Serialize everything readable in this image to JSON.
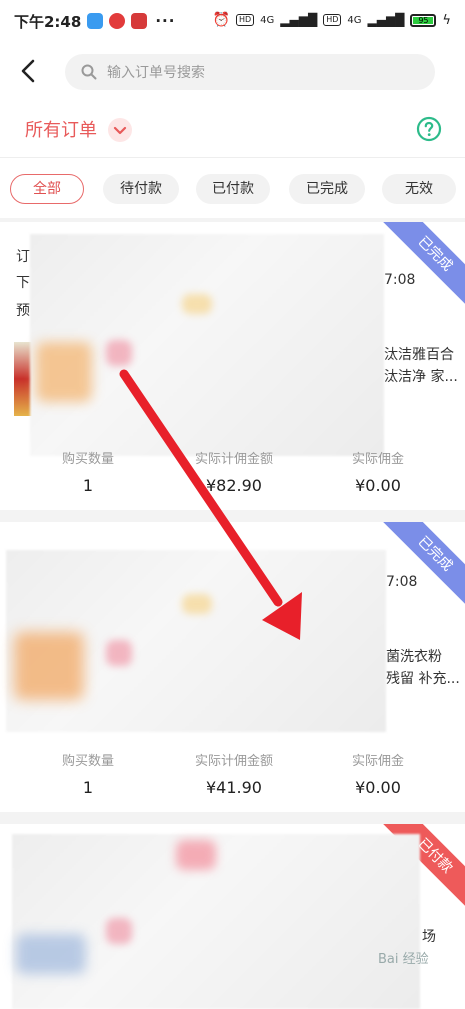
{
  "status_bar": {
    "time": "下午2:48",
    "more": "···",
    "signal_1": "4G",
    "signal_2": "4G",
    "chip_1": "HD",
    "chip_2": "HD",
    "battery": "95"
  },
  "header": {
    "search_placeholder": "输入订单号搜索"
  },
  "titlebar": {
    "title": "所有订单"
  },
  "tabs": [
    "全部",
    "待付款",
    "已付款",
    "已完成",
    "无效"
  ],
  "orders": [
    {
      "ribbon": "已完成",
      "ribbon_color": "#7b8ee8",
      "peek_left": [
        "订",
        "下",
        "预"
      ],
      "peek_time": "7:08",
      "peek_title_1": "汰洁雅百合",
      "peek_title_2": "汰洁净 家...",
      "labels": [
        "购买数量",
        "实际计佣金额",
        "实际佣金"
      ],
      "values": [
        "1",
        "¥82.90",
        "¥0.00"
      ]
    },
    {
      "ribbon": "已完成",
      "ribbon_color": "#7b8ee8",
      "peek_time": "7:08",
      "peek_title_1": "菌洗衣粉",
      "peek_title_2": "残留 补充...",
      "labels": [
        "购买数量",
        "实际计佣金额",
        "实际佣金"
      ],
      "values": [
        "1",
        "¥41.90",
        "¥0.00"
      ]
    },
    {
      "ribbon": "已付款",
      "ribbon_color": "#ee5a5a",
      "peek_title_1": "场"
    }
  ],
  "watermark": "Bai 经验"
}
